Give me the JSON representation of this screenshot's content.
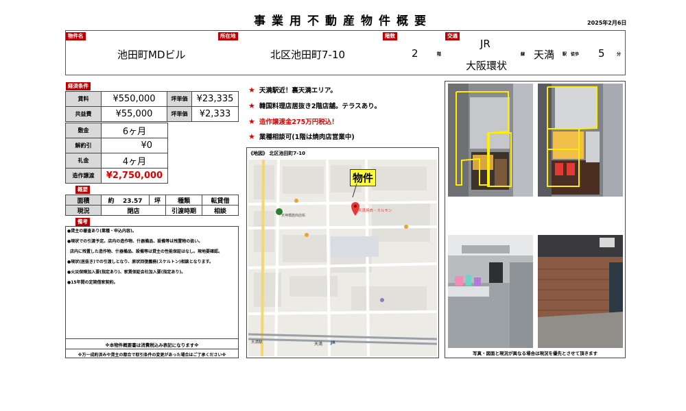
{
  "title": "事業用不動産物件概要",
  "date": "2025年2月6日",
  "header": {
    "name_label": "物件名",
    "name": "池田町MDビル",
    "location_label": "所在地",
    "location": "北区池田町7-10",
    "floor_label": "階数",
    "floor": "2",
    "floor_unit": "階",
    "transport_label": "交通",
    "line_top": "JR",
    "line_bottom": "大阪環状",
    "line_unit": "線",
    "station": "天満",
    "station_unit": "駅",
    "walk_label": "徒歩",
    "walk": "5",
    "walk_unit": "分"
  },
  "conditions": {
    "label": "経済条件",
    "rent_label": "賃料",
    "rent": "¥550,000",
    "rent_tsubo_label": "坪単価",
    "rent_tsubo": "¥23,335",
    "common_label": "共益費",
    "common": "¥55,000",
    "common_tsubo_label": "坪単価",
    "common_tsubo": "¥2,333",
    "deposit_label": "敷金",
    "deposit": "6ヶ月",
    "amort_label": "解約引",
    "amort": "¥0",
    "keymoney_label": "礼金",
    "keymoney": "4ヶ月",
    "transfer_label": "造作譲渡",
    "transfer": "¥2,750,000"
  },
  "overview": {
    "label": "概要",
    "area_label": "面積",
    "area_prefix": "約",
    "area": "23.57",
    "area_unit": "坪",
    "type_label": "種類",
    "type": "転貸借",
    "status_label": "現況",
    "status": "閉店",
    "handover_label": "引渡時期",
    "handover": "相談"
  },
  "remarks": {
    "label": "備考",
    "items": [
      "●貸主の審査あり(業種・申込内容)。",
      "●現状での引渡予定。店内の造作物、什器備品、設備等は残置物の扱い。",
      "店内に残置した造作物、什器備品、設備等は貸主の性能保証はなし。現地要確認。",
      "●現状(居抜き)での引渡しとなり、原状回復義務(スケルトン)相談となります。",
      "●火災保険加入要(指定あり)、家賃保証会社加入要(指定あり)。",
      "●15年間の定期借家契約。"
    ],
    "footer1": "※本物件概要書は消費税込み表記になります※",
    "footer2": "※万一成約済みや貸主の都合で取引条件の変更があった場合はご了承ください※"
  },
  "points": [
    "天満駅近！裏天満エリア。",
    "韓国料理店居抜き2階店舗。テラスあり。",
    "造作譲渡金275万円税込！",
    "業種相談可(1階は焼肉店営業中)"
  ],
  "points_star": "★",
  "map": {
    "label": "《地図》 北区池田町7-10",
    "marker": "物件",
    "labels": [
      "天満焼肉・ホルモン",
      "天神橋筋商店街",
      "天満",
      "JR",
      "天満駅"
    ]
  },
  "photos": {
    "caption": "写真・図面と現況が異なる場合は現況を優先とさせて頂きます"
  },
  "colors": {
    "label_red": "#c00000",
    "accent_red": "#e00000",
    "marker_yellow": "#ffff33"
  }
}
